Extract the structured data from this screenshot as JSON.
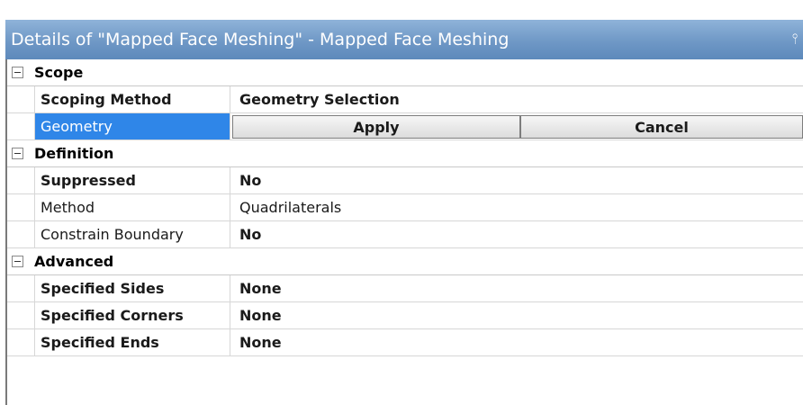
{
  "panel": {
    "title": "Details of \"Mapped Face Meshing\" - Mapped Face Meshing",
    "pin_icon": "pin-icon"
  },
  "groups": [
    {
      "label": "Scope",
      "rows": [
        {
          "name": "Scoping Method",
          "value": "Geometry Selection"
        },
        {
          "name": "Geometry",
          "apply": "Apply",
          "cancel": "Cancel"
        }
      ]
    },
    {
      "label": "Definition",
      "rows": [
        {
          "name": "Suppressed",
          "value": "No"
        },
        {
          "name": "Method",
          "value": "Quadrilaterals"
        },
        {
          "name": "Constrain Boundary",
          "value": "No"
        }
      ]
    },
    {
      "label": "Advanced",
      "rows": [
        {
          "name": "Specified Sides",
          "value": "None"
        },
        {
          "name": "Specified Corners",
          "value": "None"
        },
        {
          "name": "Specified Ends",
          "value": "None"
        }
      ]
    }
  ],
  "colors": {
    "title_bar": "#6f98c6",
    "selected_row": "#2f86e8"
  }
}
